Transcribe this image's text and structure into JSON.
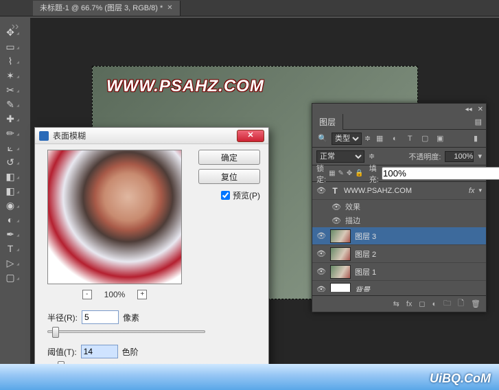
{
  "tab": {
    "title": "未标题-1 @ 66.7% (图层 3, RGB/8) *"
  },
  "canvas": {
    "watermark": "WWW.PSAHZ.COM"
  },
  "uibq": "UiBQ.CoM",
  "dialog": {
    "title": "表面模糊",
    "ok": "确定",
    "reset": "复位",
    "preview_label": "预览(P)",
    "zoom": "100%",
    "radius_label": "半径(R):",
    "radius_value": "5",
    "radius_unit": "像素",
    "threshold_label": "阈值(T):",
    "threshold_value": "14",
    "threshold_unit": "色阶"
  },
  "panel": {
    "tab": "图层",
    "filter": "类型",
    "blend": "正常",
    "opacity_label": "不透明度:",
    "opacity": "100%",
    "lock_label": "锁定:",
    "fill_label": "填充:",
    "fill": "100%",
    "layers": [
      {
        "type": "text",
        "name": "WWW.PSAHZ.COM",
        "fx": "fx"
      },
      {
        "type": "fx",
        "name": "效果"
      },
      {
        "type": "fx",
        "name": "描边"
      },
      {
        "type": "bmp",
        "name": "图层 3",
        "selected": true
      },
      {
        "type": "bmp",
        "name": "图层 2"
      },
      {
        "type": "bmp",
        "name": "图层 1"
      },
      {
        "type": "bg",
        "name": "背景"
      }
    ]
  }
}
